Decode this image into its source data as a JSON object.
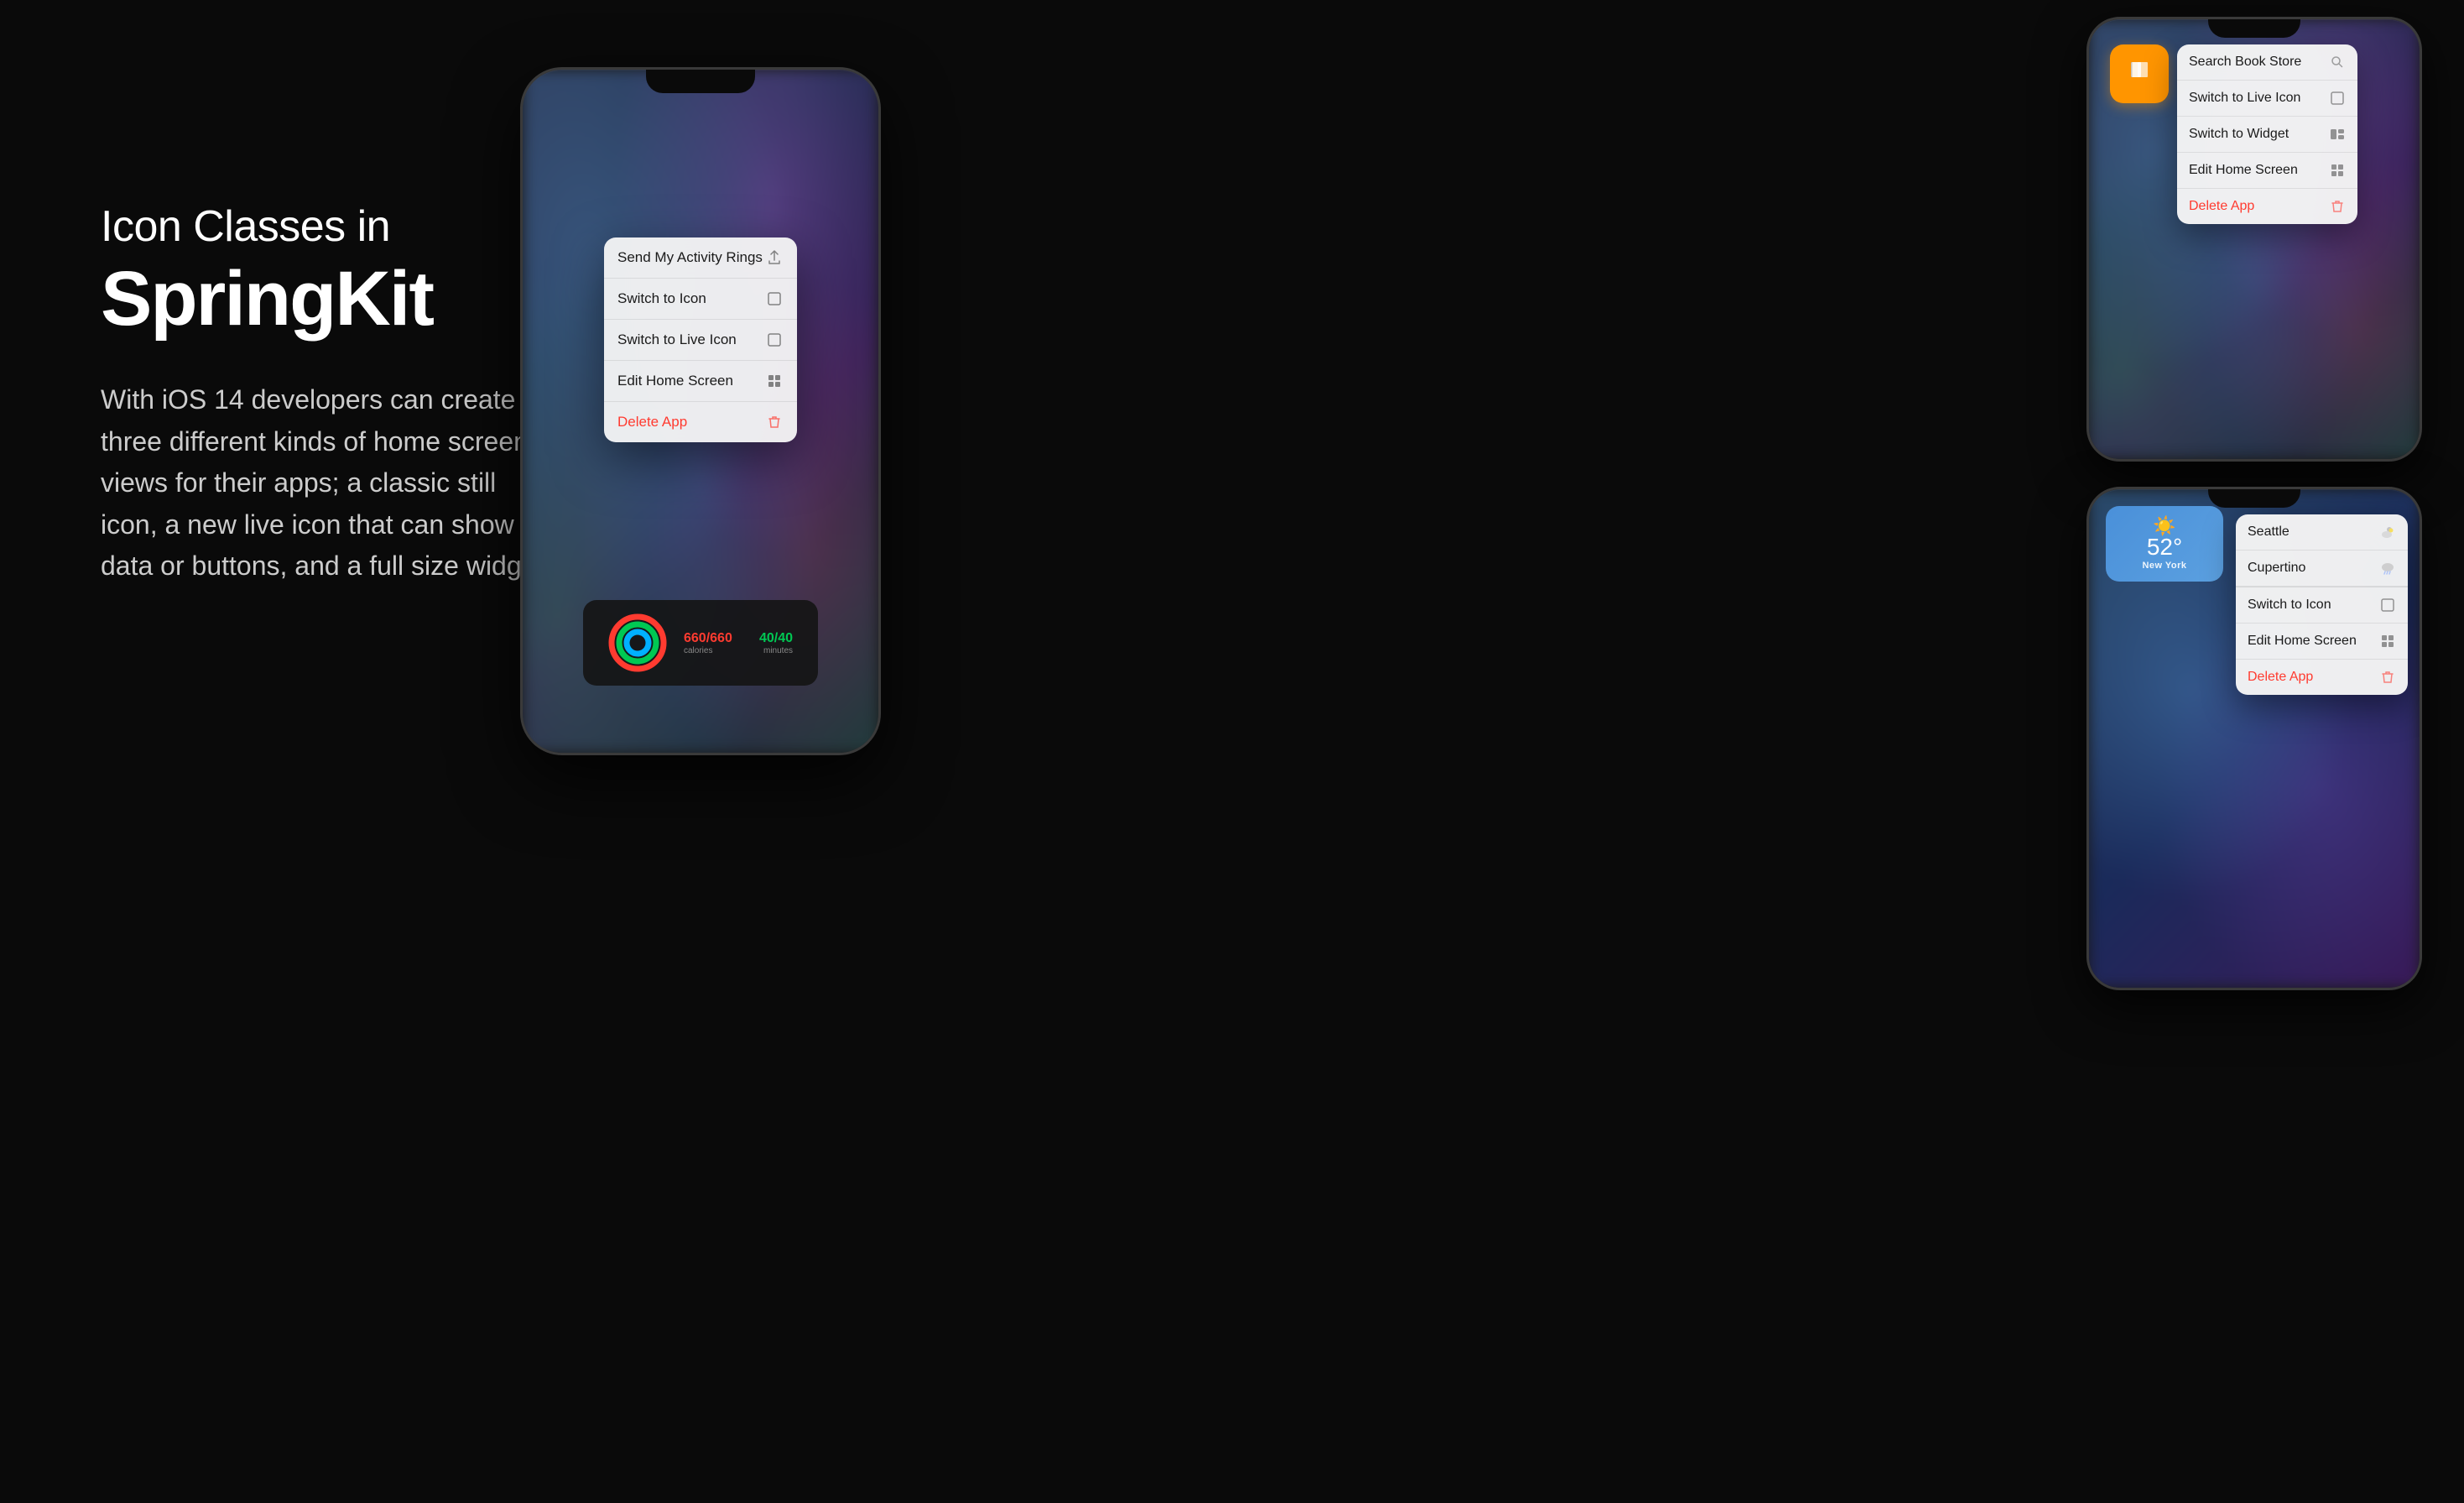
{
  "page": {
    "background": "#0a0a0a"
  },
  "text_section": {
    "subtitle": "Icon Classes in",
    "title": "SpringKit",
    "description": "With iOS 14 developers can create three different kinds of home screen views for their apps; a classic still icon, a new live icon that can show data or buttons, and a full size widget."
  },
  "center_phone": {
    "context_menu": {
      "items": [
        {
          "label": "Send My Activity Rings",
          "icon": "share",
          "red": false
        },
        {
          "label": "Switch to Icon",
          "icon": "square",
          "red": false
        },
        {
          "label": "Switch to Live Icon",
          "icon": "square",
          "red": false
        },
        {
          "label": "Edit Home Screen",
          "icon": "grid",
          "red": false
        },
        {
          "label": "Delete App",
          "icon": "trash",
          "red": true
        }
      ]
    },
    "activity": {
      "calories_value": "660/660",
      "calories_label": "calories",
      "minutes_value": "40/40",
      "minutes_label": "minutes"
    }
  },
  "top_right_phone": {
    "app_icon_color": "#ff9500",
    "context_menu": {
      "items": [
        {
          "label": "Search Book Store",
          "icon": "search",
          "red": false
        },
        {
          "label": "Switch to Live Icon",
          "icon": "square",
          "red": false
        },
        {
          "label": "Switch to Widget",
          "icon": "widget",
          "red": false
        },
        {
          "label": "Edit Home Screen",
          "icon": "grid",
          "red": false
        },
        {
          "label": "Delete App",
          "icon": "trash",
          "red": true
        }
      ]
    }
  },
  "bottom_right_phone": {
    "weather": {
      "sun_icon": "☀️",
      "temperature": "52°",
      "city": "New York"
    },
    "context_menu": {
      "items": [
        {
          "label": "Seattle",
          "icon": "cloud-sun",
          "red": false
        },
        {
          "label": "Cupertino",
          "icon": "cloud-rain",
          "red": false
        },
        {
          "label": "Switch to Icon",
          "icon": "square",
          "red": false
        },
        {
          "label": "Edit Home Screen",
          "icon": "grid",
          "red": false
        },
        {
          "label": "Delete App",
          "icon": "trash",
          "red": true
        }
      ]
    }
  },
  "icons": {
    "share": "↑",
    "square": "□",
    "grid": "⊞",
    "trash": "🗑",
    "search": "🔍",
    "cloud_sun": "⛅",
    "cloud_rain": "🌧"
  }
}
